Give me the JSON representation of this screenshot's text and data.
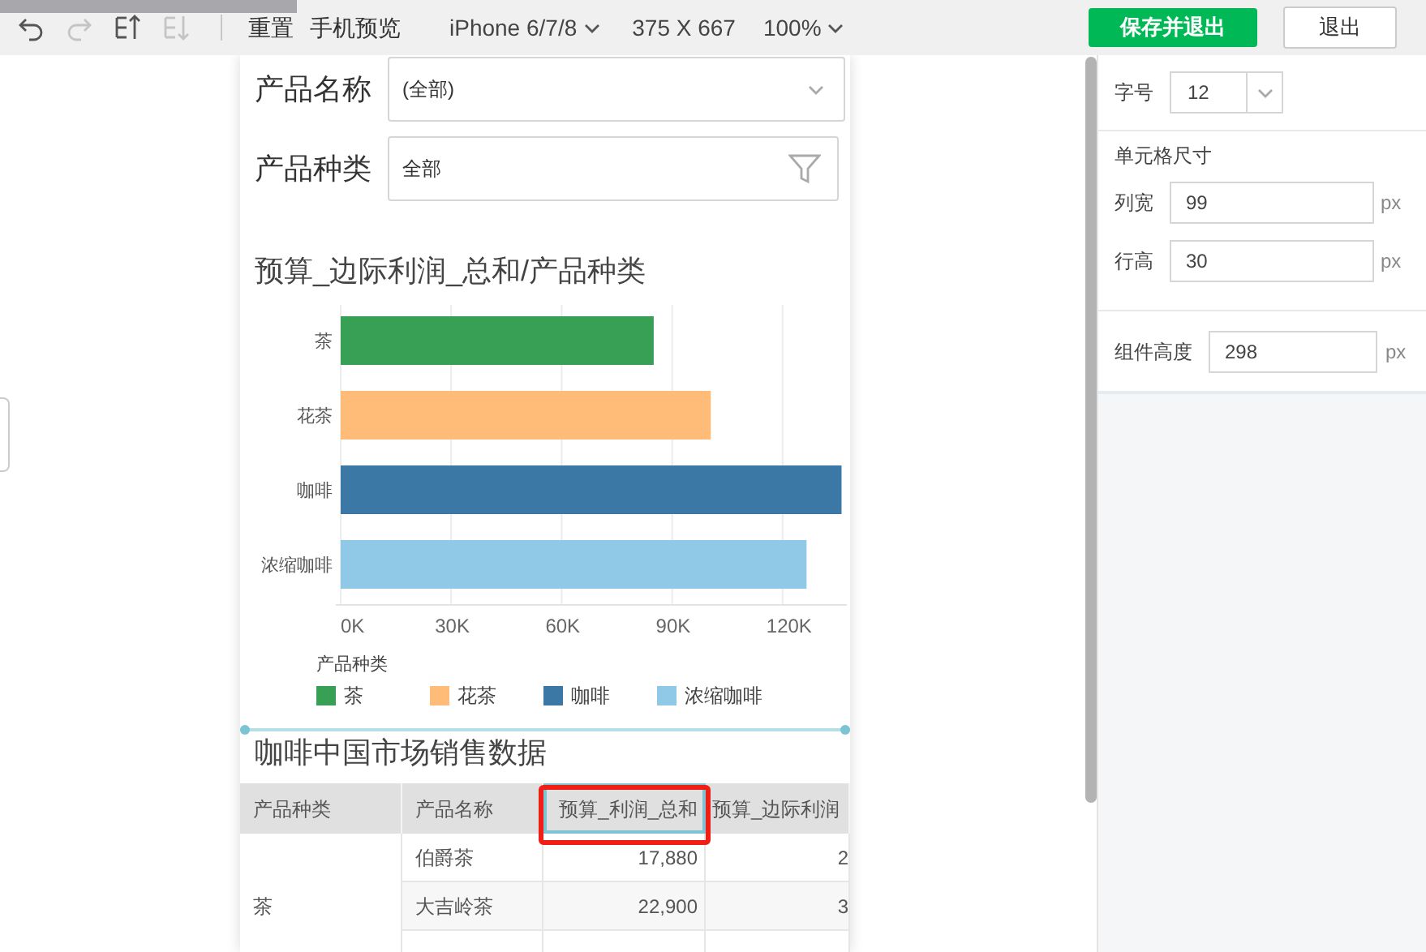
{
  "toolbar": {
    "icons": [
      {
        "kind": "undo",
        "disabled": false
      },
      {
        "kind": "redo",
        "disabled": true
      },
      {
        "kind": "sort-up",
        "disabled": false
      },
      {
        "kind": "sort-down",
        "disabled": true
      }
    ],
    "actions": [
      "重置",
      "手机预览"
    ],
    "device": "iPhone 6/7/8",
    "size": "375 X 667",
    "zoom": "100%",
    "buttons": [
      {
        "label": "保存并退出",
        "kind": "primary"
      },
      {
        "label": "退出",
        "kind": "secondary"
      }
    ]
  },
  "filters": [
    {
      "label": "产品名称",
      "value": "(全部)",
      "kind": "dropdown"
    },
    {
      "label": "产品种类",
      "value": "全部",
      "kind": "filter"
    }
  ],
  "chart": {
    "chart_data": {
      "type": "bar",
      "orientation": "horizontal",
      "title": "预算_边际利润_总和/产品种类",
      "categories": [
        "茶",
        "花茶",
        "咖啡",
        "浓缩咖啡"
      ],
      "values": [
        85000,
        100500,
        136000,
        126500
      ],
      "grid": true,
      "colors": [
        "#37a055",
        "#ffbb78",
        "#3b78a6",
        "#90c9e8"
      ],
      "xlim": [
        0,
        137000
      ],
      "xticks": [
        {
          "value": 0,
          "label": "0K"
        },
        {
          "value": 30000,
          "label": "30K"
        },
        {
          "value": 60000,
          "label": "60K"
        },
        {
          "value": 90000,
          "label": "90K"
        },
        {
          "value": 120000,
          "label": "120K"
        }
      ]
    },
    "legend": {
      "title": "产品种类",
      "items": [
        {
          "label": "茶",
          "color": "#37a055"
        },
        {
          "label": "花茶",
          "color": "#ffbb78"
        },
        {
          "label": "咖啡",
          "color": "#3b78a6"
        },
        {
          "label": "浓缩咖啡",
          "color": "#90c9e8"
        }
      ]
    }
  },
  "table": {
    "title": "咖啡中国市场销售数据",
    "columns": [
      {
        "label": "产品种类",
        "selected": false
      },
      {
        "label": "产品名称",
        "selected": false
      },
      {
        "label": "预算_利润_总和",
        "selected": true
      },
      {
        "label": "预算_边际利润",
        "selected": false
      }
    ],
    "groups": [
      {
        "category": "茶",
        "rows": [
          [
            "伯爵茶",
            "17,880",
            "2"
          ],
          [
            "大吉岭茶",
            "22,900",
            "3"
          ],
          [
            "",
            "",
            ""
          ]
        ]
      }
    ]
  },
  "panel": {
    "font_size": {
      "label": "字号",
      "value": "12"
    },
    "cell_size": {
      "title": "单元格尺寸",
      "fields": [
        {
          "label": "列宽",
          "value": "99",
          "unit": "px"
        },
        {
          "label": "行高",
          "value": "30",
          "unit": "px"
        }
      ]
    },
    "height": {
      "label": "组件高度",
      "value": "298",
      "unit": "px"
    }
  }
}
